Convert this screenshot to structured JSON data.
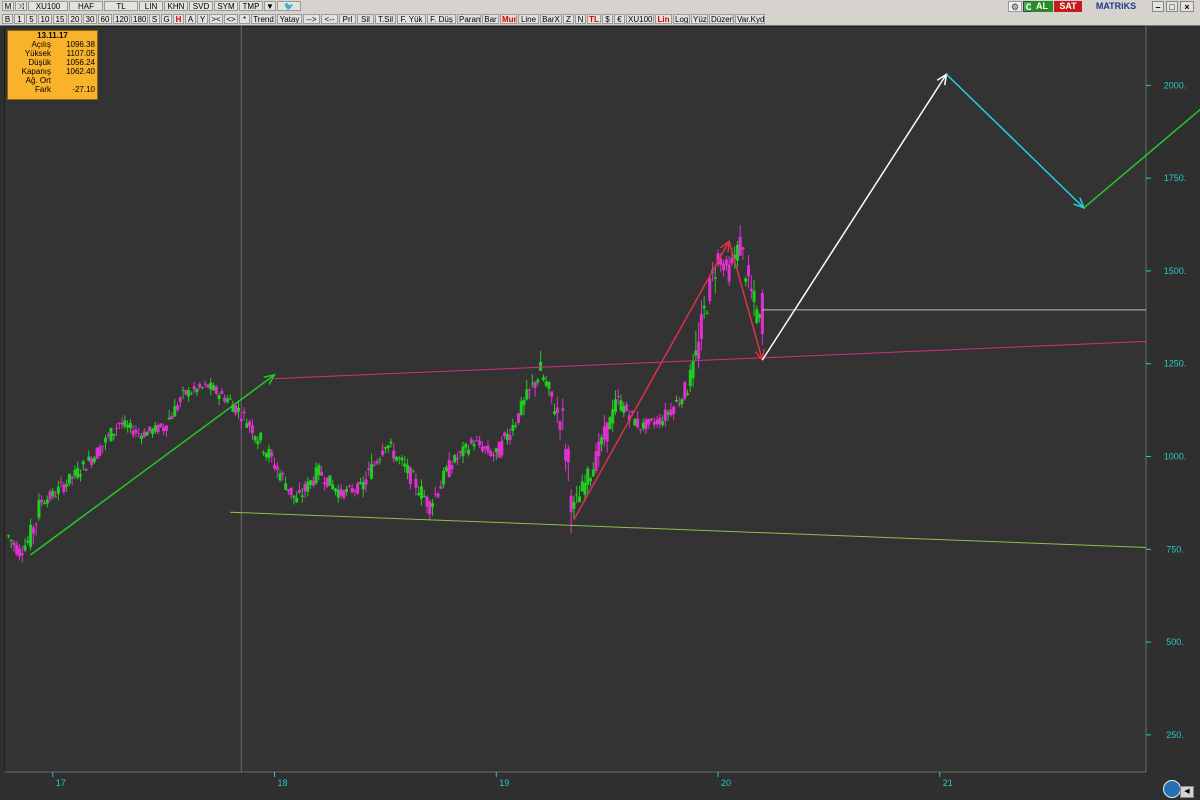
{
  "toolbar": {
    "row1": [
      "M",
      "⤨",
      "XU100",
      "HAF",
      "TL",
      "LIN",
      "KHN",
      "SVD",
      "SYM",
      "TMP",
      "▼",
      "🐦"
    ],
    "row2": [
      "B",
      "1",
      "5",
      "10",
      "15",
      "20",
      "30",
      "60",
      "120",
      "180",
      "S",
      "G",
      "H",
      "A",
      "Y",
      "><",
      "<>",
      "*",
      "Trend",
      "Yatay",
      "-->",
      "<--",
      "Prl",
      "Sil",
      "T.Sil",
      "F. Yük",
      "F. Düş",
      "Param",
      "Bar",
      "Mum",
      "Line",
      "BarX",
      "Z",
      "N",
      "TL",
      "$",
      "€",
      "XU100",
      "Lin",
      "Log",
      "Yüz",
      "Düzen",
      "Var.Kyd"
    ],
    "right": {
      "al": "AL",
      "sat": "SAT",
      "brand": "MATRiKS"
    }
  },
  "info_box": {
    "date": "13.11.17",
    "rows": [
      {
        "k": "Açılış",
        "v": "1096.38"
      },
      {
        "k": "Yüksek",
        "v": "1107.05"
      },
      {
        "k": "Düşük",
        "v": "1056.24"
      },
      {
        "k": "Kapanış",
        "v": "1062.40"
      },
      {
        "k": "Ağ. Ort",
        "v": ""
      },
      {
        "k": "Fark",
        "v": "-27.10"
      }
    ]
  },
  "colors": {
    "up": "#22cc22",
    "down": "#e030d0",
    "axis_text": "#28c8c8",
    "magenta_line": "#d0308a",
    "green_line": "#8bc34a",
    "grey_line": "#bdbdbd"
  },
  "chart_data": {
    "type": "candlestick",
    "symbol": "XU100",
    "x_ticks": [
      "17",
      "18",
      "19",
      "20",
      "21"
    ],
    "y_ticks": [
      250,
      500,
      750,
      1000,
      1250,
      1500,
      1750,
      2000
    ],
    "ylim": [
      150,
      2160
    ],
    "x_range": [
      16.78,
      21.93
    ],
    "series": [
      {
        "t": 16.8,
        "o": 790,
        "h": 800,
        "l": 770,
        "c": 785
      },
      {
        "t": 16.85,
        "o": 780,
        "h": 790,
        "l": 735,
        "c": 745
      },
      {
        "t": 16.9,
        "o": 745,
        "h": 790,
        "l": 735,
        "c": 780
      },
      {
        "t": 16.95,
        "o": 790,
        "h": 900,
        "l": 780,
        "c": 880
      },
      {
        "t": 17.0,
        "o": 880,
        "h": 910,
        "l": 860,
        "c": 895
      },
      {
        "t": 17.1,
        "o": 900,
        "h": 960,
        "l": 880,
        "c": 950
      },
      {
        "t": 17.2,
        "o": 950,
        "h": 1020,
        "l": 940,
        "c": 1010
      },
      {
        "t": 17.3,
        "o": 1010,
        "h": 1100,
        "l": 990,
        "c": 1090
      },
      {
        "t": 17.4,
        "o": 1090,
        "h": 1110,
        "l": 1040,
        "c": 1060
      },
      {
        "t": 17.5,
        "o": 1060,
        "h": 1120,
        "l": 990,
        "c": 1080
      },
      {
        "t": 17.6,
        "o": 1080,
        "h": 1200,
        "l": 1060,
        "c": 1170
      },
      {
        "t": 17.7,
        "o": 1170,
        "h": 1220,
        "l": 1150,
        "c": 1190
      },
      {
        "t": 17.8,
        "o": 1190,
        "h": 1200,
        "l": 1130,
        "c": 1150
      },
      {
        "t": 17.9,
        "o": 1150,
        "h": 1180,
        "l": 1070,
        "c": 1080
      },
      {
        "t": 18.0,
        "o": 1080,
        "h": 1100,
        "l": 960,
        "c": 980
      },
      {
        "t": 18.1,
        "o": 980,
        "h": 990,
        "l": 860,
        "c": 880
      },
      {
        "t": 18.2,
        "o": 880,
        "h": 1000,
        "l": 870,
        "c": 960
      },
      {
        "t": 18.3,
        "o": 960,
        "h": 970,
        "l": 880,
        "c": 900
      },
      {
        "t": 18.4,
        "o": 900,
        "h": 940,
        "l": 880,
        "c": 920
      },
      {
        "t": 18.5,
        "o": 920,
        "h": 1060,
        "l": 900,
        "c": 1040
      },
      {
        "t": 18.6,
        "o": 1040,
        "h": 1060,
        "l": 940,
        "c": 960
      },
      {
        "t": 18.7,
        "o": 960,
        "h": 980,
        "l": 850,
        "c": 870
      },
      {
        "t": 18.8,
        "o": 870,
        "h": 1000,
        "l": 860,
        "c": 980
      },
      {
        "t": 18.9,
        "o": 980,
        "h": 1060,
        "l": 960,
        "c": 1040
      },
      {
        "t": 19.0,
        "o": 1040,
        "h": 1060,
        "l": 980,
        "c": 1000
      },
      {
        "t": 19.1,
        "o": 1000,
        "h": 1130,
        "l": 990,
        "c": 1110
      },
      {
        "t": 19.2,
        "o": 1110,
        "h": 1250,
        "l": 1100,
        "c": 1230
      },
      {
        "t": 19.3,
        "o": 1230,
        "h": 1240,
        "l": 1060,
        "c": 1080
      },
      {
        "t": 19.35,
        "o": 1080,
        "h": 1090,
        "l": 840,
        "c": 860
      },
      {
        "t": 19.45,
        "o": 860,
        "h": 1000,
        "l": 830,
        "c": 990
      },
      {
        "t": 19.55,
        "o": 990,
        "h": 1160,
        "l": 980,
        "c": 1150
      },
      {
        "t": 19.65,
        "o": 1150,
        "h": 1170,
        "l": 1060,
        "c": 1080
      },
      {
        "t": 19.75,
        "o": 1080,
        "h": 1120,
        "l": 990,
        "c": 1100
      },
      {
        "t": 19.85,
        "o": 1100,
        "h": 1180,
        "l": 1090,
        "c": 1170
      },
      {
        "t": 19.9,
        "o": 1170,
        "h": 1260,
        "l": 1160,
        "c": 1250
      },
      {
        "t": 19.95,
        "o": 1250,
        "h": 1440,
        "l": 1240,
        "c": 1420
      },
      {
        "t": 20.0,
        "o": 1420,
        "h": 1560,
        "l": 1410,
        "c": 1540
      },
      {
        "t": 20.05,
        "o": 1540,
        "h": 1590,
        "l": 1480,
        "c": 1500
      },
      {
        "t": 20.1,
        "o": 1500,
        "h": 1590,
        "l": 1490,
        "c": 1570
      },
      {
        "t": 20.15,
        "o": 1570,
        "h": 1590,
        "l": 1420,
        "c": 1440
      },
      {
        "t": 20.2,
        "o": 1440,
        "h": 1450,
        "l": 1300,
        "c": 1330
      }
    ],
    "drawings": [
      {
        "kind": "arrow",
        "color": "#22cc22",
        "from": [
          16.9,
          735
        ],
        "to": [
          18.0,
          1220
        ]
      },
      {
        "kind": "line",
        "color": "#d0308a",
        "from": [
          18.0,
          1210
        ],
        "to": [
          21.93,
          1310
        ]
      },
      {
        "kind": "line",
        "color": "#8bc34a",
        "from": [
          17.8,
          850
        ],
        "to": [
          21.93,
          755
        ]
      },
      {
        "kind": "arrow",
        "color": "#e0304a",
        "from": [
          19.35,
          830
        ],
        "to": [
          20.05,
          1580
        ]
      },
      {
        "kind": "arrow",
        "color": "#e0304a",
        "from": [
          20.05,
          1580
        ],
        "to": [
          20.2,
          1260
        ]
      },
      {
        "kind": "line",
        "color": "#bdbdbd",
        "from": [
          20.2,
          1395
        ],
        "to": [
          21.93,
          1395
        ]
      },
      {
        "kind": "arrow",
        "color": "#ffffff",
        "from": [
          20.2,
          1260
        ],
        "to": [
          21.03,
          2030
        ]
      },
      {
        "kind": "arrow",
        "color": "#28d0e0",
        "from": [
          21.03,
          2030
        ],
        "to": [
          21.65,
          1670
        ]
      },
      {
        "kind": "arrow",
        "color": "#22cc22",
        "from": [
          21.65,
          1670
        ],
        "to": [
          22.6,
          2150
        ]
      }
    ]
  }
}
